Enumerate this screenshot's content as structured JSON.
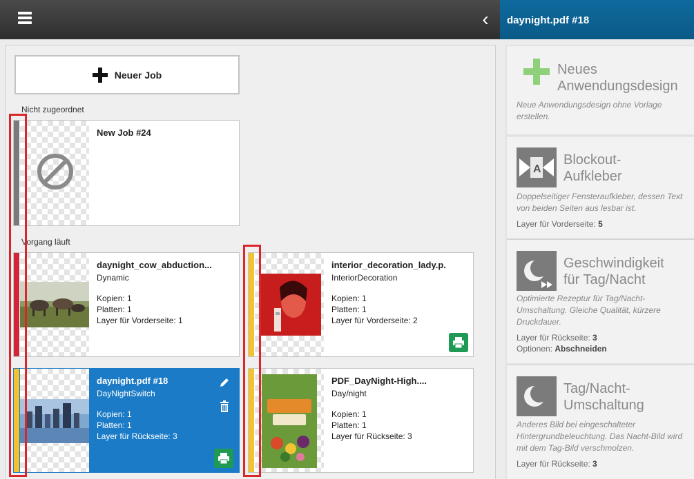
{
  "header": {
    "doc_title": "daynight.pdf #18"
  },
  "new_job": {
    "label": "Neuer Job"
  },
  "sections": {
    "unassigned": "Nicht zugeordnet",
    "running": "Vorgang läuft"
  },
  "jobs": {
    "new24": {
      "name": "New Job #24"
    },
    "cow": {
      "name": "daynight_cow_abduction....",
      "type": "Dynamic",
      "copies": "Kopien: 1",
      "plates": "Platten: 1",
      "layer": "Layer für Vorderseite: 1"
    },
    "lady": {
      "name": "interior_decoration_lady.p...",
      "type": "InteriorDecoration",
      "copies": "Kopien: 1",
      "plates": "Platten: 1",
      "layer": "Layer für Vorderseite: 2"
    },
    "daynight": {
      "name": "daynight.pdf #18",
      "type": "DayNightSwitch",
      "copies": "Kopien: 1",
      "plates": "Platten: 1",
      "layer": "Layer für Rückseite: 3"
    },
    "pdfdn": {
      "name": "PDF_DayNight-High....",
      "type": "Day/night",
      "copies": "Kopien: 1",
      "plates": "Platten: 1",
      "layer": "Layer für Rückseite: 3"
    }
  },
  "templates": {
    "neu": {
      "title1": "Neues",
      "title2": "Anwendungsdesign",
      "desc": "Neue Anwendungsdesign ohne Vorlage erstellen."
    },
    "blockout": {
      "title1": "Blockout-",
      "title2": "Aufkleber",
      "desc": "Doppelseitiger Fensteraufkleber, dessen Text von beiden Seiten aus lesbar ist.",
      "meta_label": "Layer für Vorderseite: ",
      "meta_value": "5"
    },
    "speed": {
      "title1": "Geschwindigkeit",
      "title2": "für Tag/Nacht",
      "desc": "Optimierte Rezeptur für Tag/Nacht-Umschaltung. Gleiche Qualität, kürzere Druckdauer.",
      "meta_label": "Layer für Rückseite: ",
      "meta_value": "3",
      "opt_label": "Optionen: ",
      "opt_value": "Abschneiden"
    },
    "daynight": {
      "title1": "Tag/Nacht-",
      "title2": "Umschaltung",
      "desc": "Anderes Bild bei eingeschalteter Hintergrundbeleuchtung. Das Nacht-Bild wird mit dem Tag-Bild verschmolzen.",
      "meta_label": "Layer für Rückseite: ",
      "meta_value": "3"
    }
  },
  "colors": {
    "selected": "#1b7bc6",
    "stripe_gray": "#7a7a7a",
    "stripe_red": "#d1263a",
    "stripe_yellow": "#f2c233",
    "print_green": "#1f9a55",
    "highlight_red": "#d9262b",
    "header_blue": "#0e6a9e"
  }
}
